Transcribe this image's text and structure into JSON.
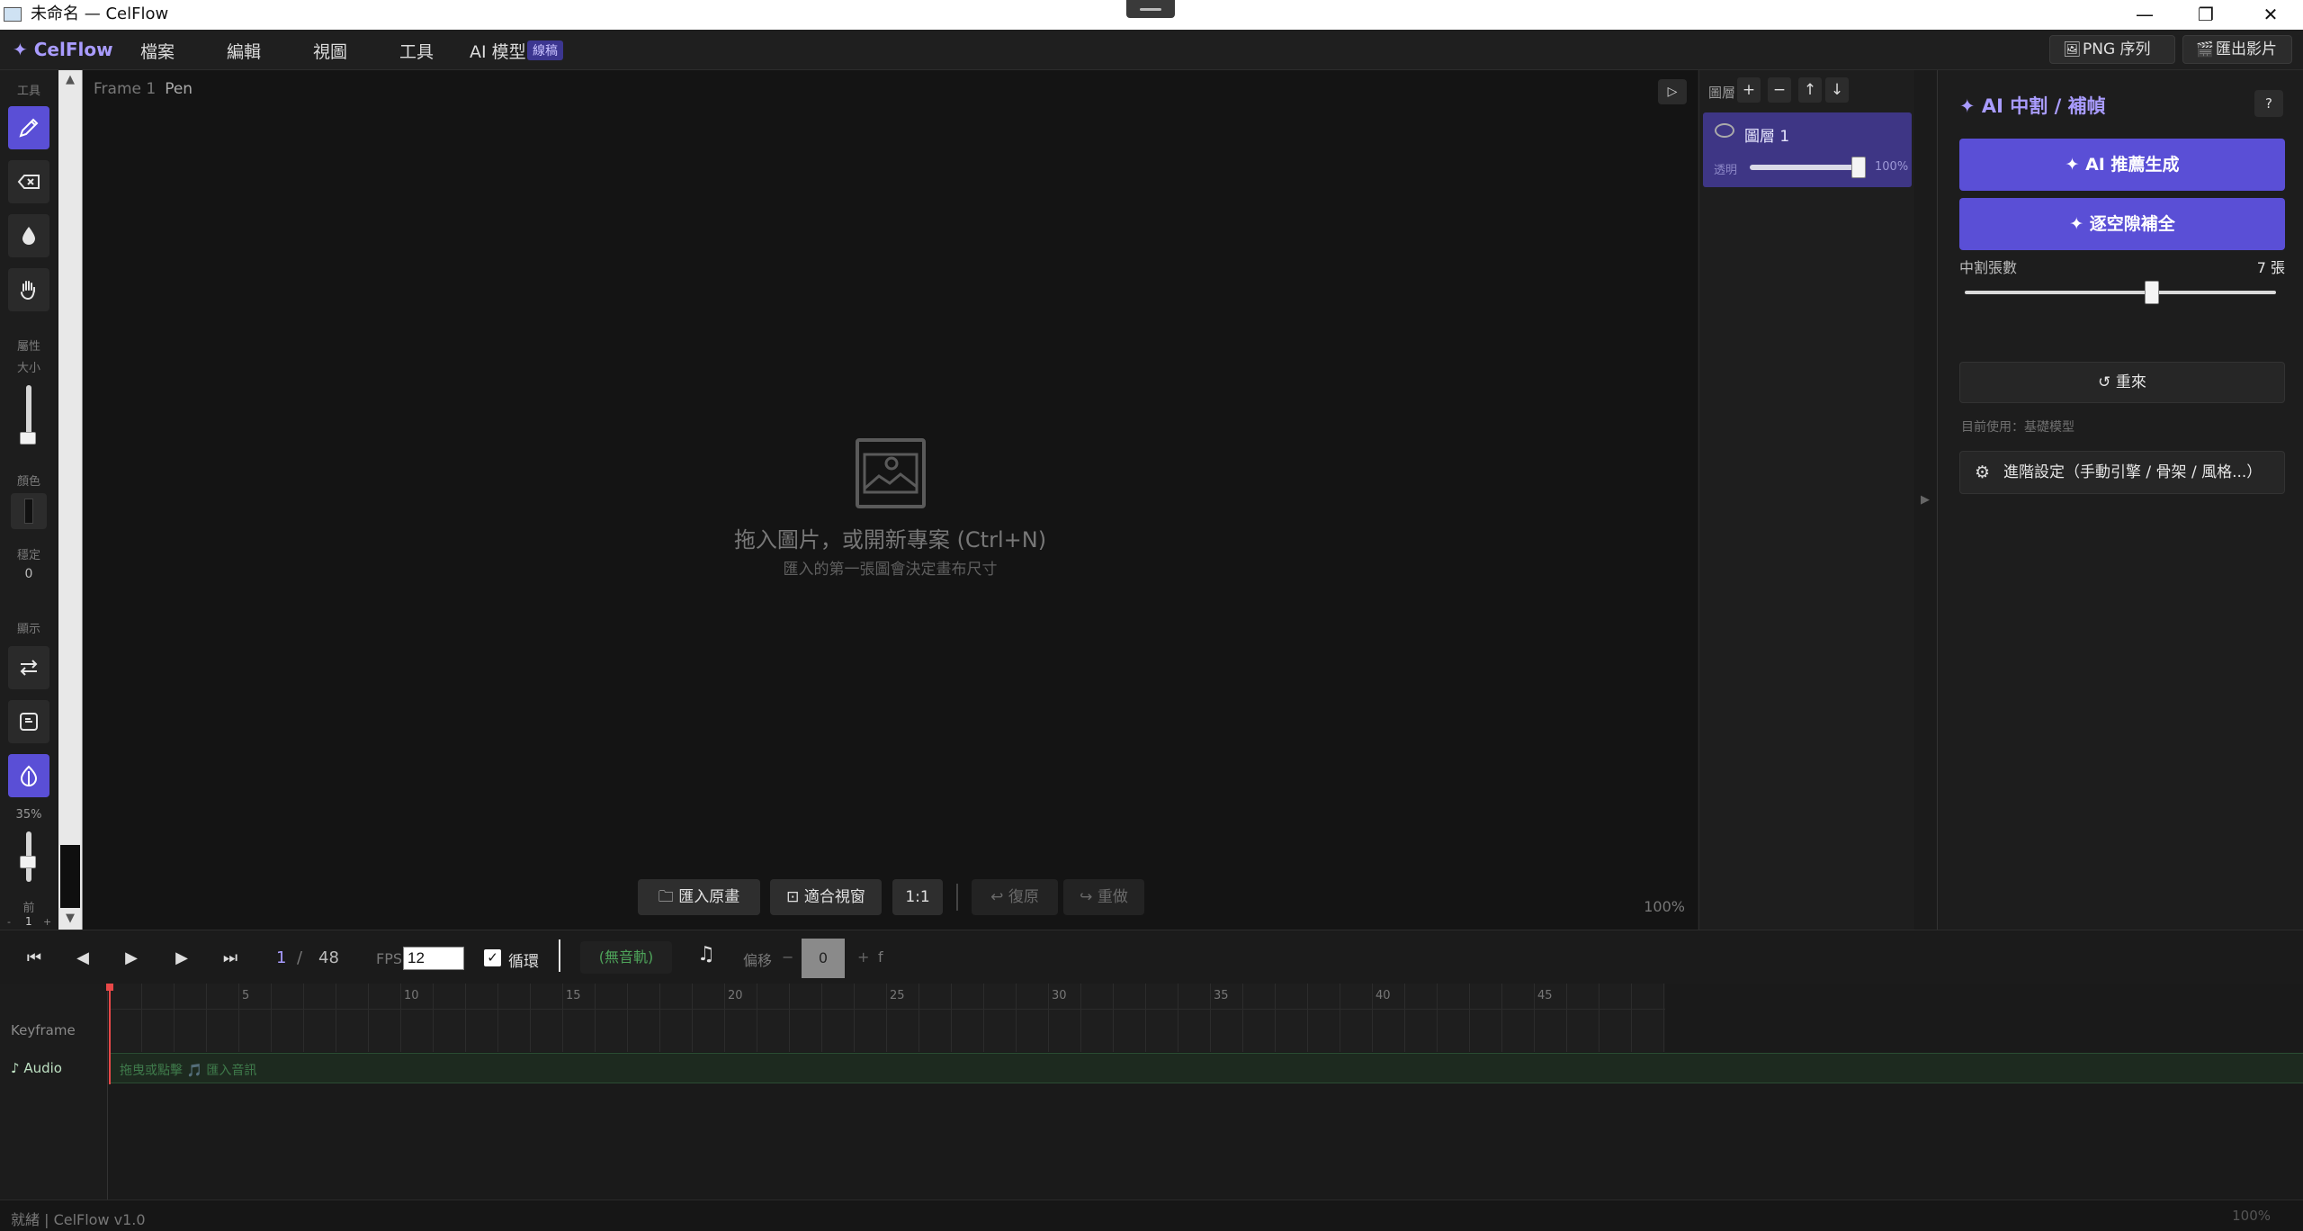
{
  "window": {
    "title": "未命名 — CelFlow",
    "controls": [
      "—",
      "❐",
      "✕"
    ]
  },
  "menubar": {
    "brand": "✦ CelFlow",
    "items": [
      "檔案",
      "編輯",
      "視圖",
      "工具"
    ],
    "ai_model_label": "AI 模型",
    "ai_model_badge": "線稿",
    "export_png_label": "PNG 序列",
    "export_video_label": "匯出影片"
  },
  "left_toolbar": {
    "tools_label": "工具",
    "props_label": "屬性",
    "size_label": "大小",
    "color_label": "顏色",
    "stabilize_label": "穩定",
    "stabilize_value": "0",
    "display_label": "顯示",
    "onion_percent": "35%",
    "onion_front_label": "前",
    "onion_front_minus": "-",
    "onion_front_value": "1",
    "onion_front_plus": "+",
    "active_tool": "pen",
    "brush_color": "#111111"
  },
  "canvas": {
    "frame_label": "Frame 1",
    "tool_label": "Pen",
    "empty_title": "拖入圖片，或開新專案 (Ctrl+N)",
    "empty_subtitle": "匯入的第一張圖會決定畫布尺寸",
    "import_label": "匯入原畫",
    "fit_label": "適合視窗",
    "one_to_one_label": "1:1",
    "undo_label": "↩ 復原",
    "redo_label": "↪ 重做",
    "zoom_label": "100%"
  },
  "layers": {
    "header": "圖層",
    "add": "+",
    "remove": "−",
    "up": "↑",
    "down": "↓",
    "items": [
      {
        "name": "圖層 1",
        "opacity_label": "透明",
        "opacity_value": "100%",
        "opacity": 1.0
      }
    ]
  },
  "ai_panel": {
    "title": "✦ AI 中割 / 補幀",
    "help": "?",
    "generate_label": "✦ AI 推薦生成",
    "fill_gaps_label": "✦ 逐空隙補全",
    "count_label": "中割張數",
    "count_value": "7 張",
    "count_level": 0.6,
    "reset_label": "↺ 重來",
    "model_text": "目前使用：基礎模型",
    "advanced_label": "進階設定（手動引擎 / 骨架 / 風格...）"
  },
  "transport": {
    "frame_current": "1",
    "frame_sep": "/",
    "frame_total": "48",
    "fps_label": "FPS",
    "fps_value": "12",
    "loop_label": "循環",
    "loop_checked": true,
    "no_track": "(無音軌)",
    "offset_label": "偏移",
    "offset_minus": "−",
    "offset_value": "0",
    "offset_plus": "+",
    "offset_unit": "f"
  },
  "timeline": {
    "keyframe_label": "Keyframe",
    "audio_label": "♪ Audio",
    "audio_hint": "拖曳或點擊 🎵 匯入音訊",
    "ticks": [
      "5",
      "10",
      "15",
      "20",
      "25",
      "30",
      "35",
      "40",
      "45"
    ]
  },
  "status": {
    "text": "就緒 | CelFlow v1.0",
    "zoom": "100%"
  },
  "colors": {
    "accent": "#5a4fd6",
    "accent_text": "#a99cff",
    "layer_selected": "#3e3685",
    "playhead": "#e84848",
    "audio_track": "#1d2a1f"
  }
}
